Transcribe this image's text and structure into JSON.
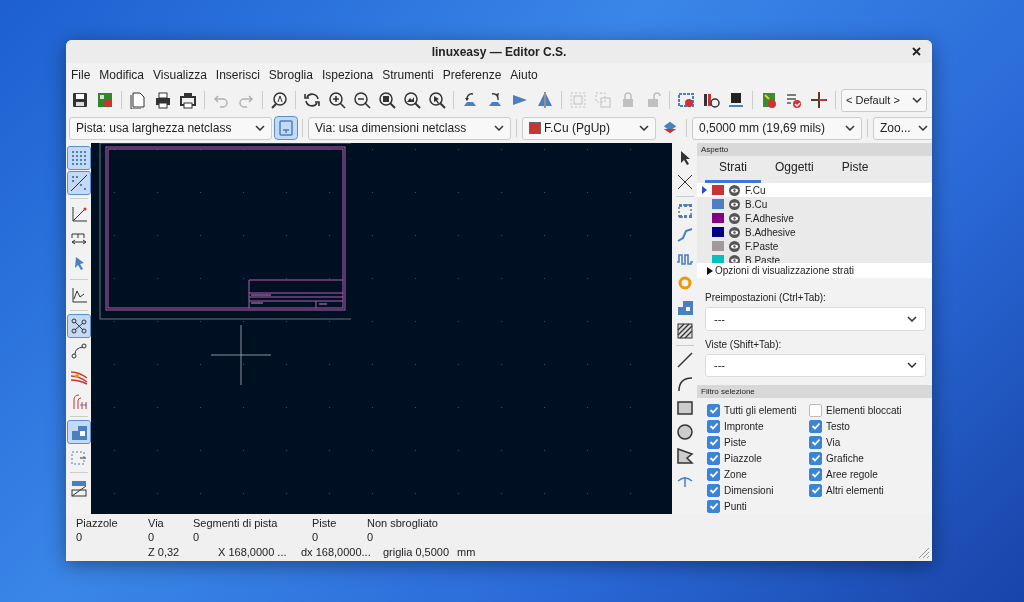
{
  "window": {
    "title": "linuxeasy — Editor C.S."
  },
  "menu": [
    "File",
    "Modifica",
    "Visualizza",
    "Inserisci",
    "Sbroglia",
    "Ispeziona",
    "Strumenti",
    "Preferenze",
    "Aiuto"
  ],
  "main_toolbar": [
    {
      "disabled": false
    },
    {
      "disabled": false
    },
    {
      "disabled": false
    },
    {
      "disabled": false
    },
    {
      "disabled": false
    },
    {
      "disabled": true
    },
    {
      "disabled": true
    },
    {
      "disabled": false
    },
    {
      "disabled": false
    },
    {
      "disabled": false
    },
    {
      "disabled": false
    },
    {
      "disabled": false
    },
    {
      "disabled": false
    },
    {
      "disabled": false
    },
    {
      "disabled": false
    },
    {
      "disabled": false
    },
    {
      "disabled": false
    },
    {
      "disabled": false
    },
    {
      "disabled": true
    },
    {
      "disabled": true
    },
    {
      "disabled": true
    },
    {
      "disabled": true
    },
    {
      "disabled": false
    },
    {
      "disabled": false
    },
    {
      "disabled": false
    },
    {
      "disabled": false
    },
    {
      "disabled": false
    },
    {
      "disabled": false
    }
  ],
  "viewport_preset": "< Default >",
  "track_width": "Pista: usa larghezza netclass",
  "auto_width": {
    "selected": true
  },
  "via_size": "Via: usa dimensioni netclass",
  "active_layer": {
    "label": "F.Cu (PgUp)",
    "color": "#c83434"
  },
  "grid": "0,5000 mm (19,69 mils)",
  "zoom": "Zoo...",
  "left_toolbar": [
    {
      "selected": true
    },
    {
      "selected": true
    },
    {
      "selected": false
    },
    {
      "selected": false
    },
    {
      "selected": false
    },
    {
      "selected": false
    },
    {
      "selected": true
    },
    {
      "selected": false
    },
    {
      "selected": false
    },
    {
      "selected": false
    },
    {
      "selected": true
    },
    {
      "selected": false
    },
    {
      "selected": false
    }
  ],
  "panel": {
    "title": "Aspetto",
    "tabs": [
      {
        "label": "Strati",
        "selected": true
      },
      {
        "label": "Oggetti",
        "selected": false
      },
      {
        "label": "Piste",
        "selected": false
      }
    ],
    "layers": [
      {
        "name": "F.Cu",
        "color": "#c83434",
        "selected": true
      },
      {
        "name": "B.Cu",
        "color": "#4d7fc4",
        "selected": false
      },
      {
        "name": "F.Adhesive",
        "color": "#840084",
        "selected": false
      },
      {
        "name": "B.Adhesive",
        "color": "#000084",
        "selected": false
      },
      {
        "name": "F.Paste",
        "color": "#a29a9a",
        "selected": false
      },
      {
        "name": "B.Paste",
        "color": "#00c2c2",
        "selected": false
      }
    ],
    "layer_options": {
      "label": "Opzioni di visualizzazione strati",
      "expanded": false
    },
    "presets": {
      "label": "Preimpostazioni (Ctrl+Tab):",
      "value": "---"
    },
    "views": {
      "label": "Viste (Shift+Tab):",
      "value": "---"
    },
    "filter_title": "Filtro selezione",
    "filters": [
      {
        "label": "Tutti gli elementi",
        "checked": true
      },
      {
        "label": "Elementi bloccati",
        "checked": false
      },
      {
        "label": "Impronte",
        "checked": true
      },
      {
        "label": "Testo",
        "checked": true
      },
      {
        "label": "Piste",
        "checked": true
      },
      {
        "label": "Via",
        "checked": true
      },
      {
        "label": "Piazzole",
        "checked": true
      },
      {
        "label": "Grafiche",
        "checked": true
      },
      {
        "label": "Zone",
        "checked": true
      },
      {
        "label": "Aree regole",
        "checked": true
      },
      {
        "label": "Dimensioni",
        "checked": true
      },
      {
        "label": "Altri elementi",
        "checked": true
      },
      {
        "label": "Punti",
        "checked": true
      }
    ]
  },
  "status": {
    "columns": [
      {
        "label": "Piazzole",
        "value": "0"
      },
      {
        "label": "Via",
        "value": "0"
      },
      {
        "label": "Segmenti di pista",
        "value": "0"
      },
      {
        "label": "Piste",
        "value": "0"
      },
      {
        "label": "Non sbrogliato",
        "value": "0"
      }
    ],
    "coords": [
      "Z 0,32",
      "X 168,0000 ...",
      "dx 168,0000...",
      "griglia 0,5000",
      "mm"
    ]
  }
}
